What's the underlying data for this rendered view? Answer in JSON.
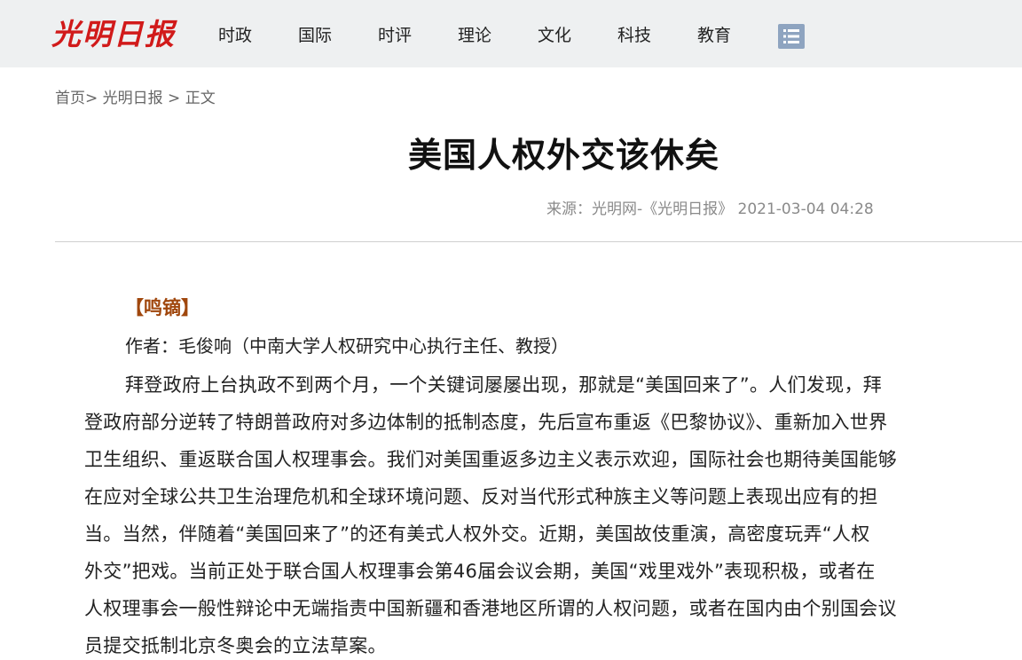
{
  "header": {
    "logo_text": "光明日报",
    "nav": [
      "时政",
      "国际",
      "时评",
      "理论",
      "文化",
      "科技",
      "教育"
    ],
    "menu_icon": "list-menu-icon"
  },
  "breadcrumb": {
    "home": "首页>",
    "site": " 光明日报",
    "sep": " > ",
    "current": "正文"
  },
  "article": {
    "title": "美国人权外交该休矣",
    "meta": "来源：光明网-《光明日报》  2021-03-04 04:28",
    "column": "【鸣镝】",
    "author": "作者：毛俊响（中南大学人权研究中心执行主任、教授）",
    "paragraph_lines": [
      "拜登政府上台执政不到两个月，一个关键词屡屡出现，那就是“美国回来了”。人们发现，拜",
      "登政府部分逆转了特朗普政府对多边体制的抵制态度，先后宣布重返《巴黎协议》、重新加入世界",
      "卫生组织、重返联合国人权理事会。我们对美国重返多边主义表示欢迎，国际社会也期待美国能够",
      "在应对全球公共卫生治理危机和全球环境问题、反对当代形式种族主义等问题上表现出应有的担",
      "当。当然，伴随着“美国回来了”的还有美式人权外交。近期，美国故伎重演，高密度玩弄“人权",
      "外交”把戏。当前正处于联合国人权理事会第46届会议会期，美国“戏里戏外”表现积极，或者在",
      "人权理事会一般性辩论中无端指责中国新疆和香港地区所谓的人权问题，或者在国内由个别国会议",
      "员提交抵制北京冬奥会的立法草案。"
    ]
  },
  "colors": {
    "logo_red": "#d11a1a",
    "topbar_bg": "#eef0f1",
    "column_brown": "#a0470d",
    "menu_icon_bg": "#8ea4c0"
  }
}
